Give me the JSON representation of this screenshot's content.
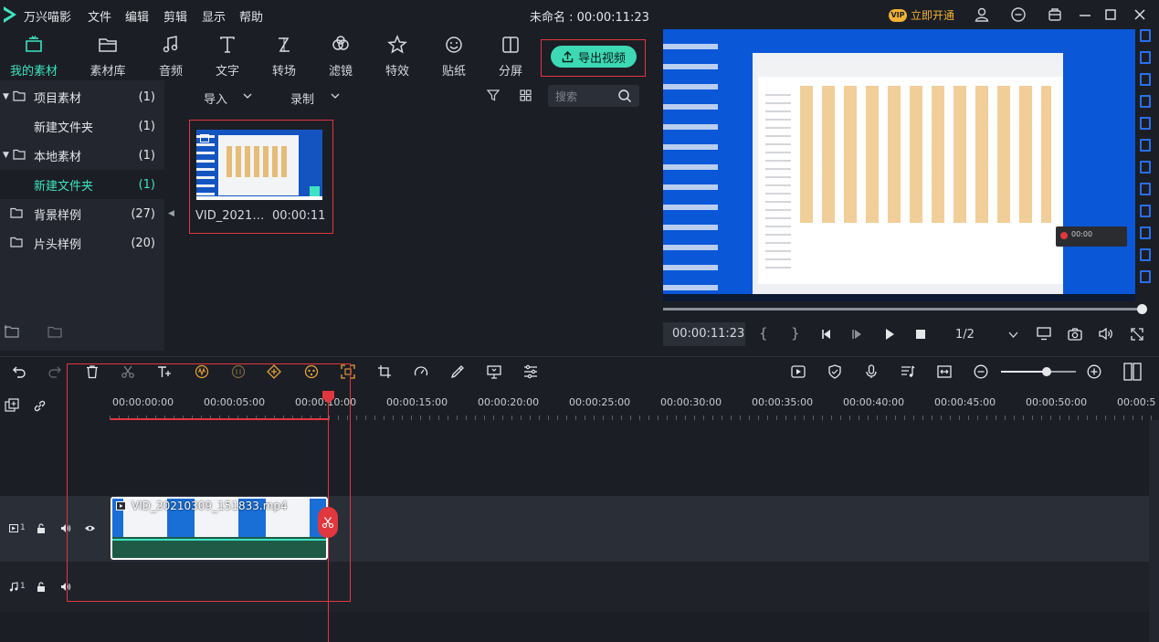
{
  "app": {
    "name": "万兴喵影",
    "title": "未命名 : 00:00:11:23",
    "menus": [
      "文件",
      "编辑",
      "剪辑",
      "显示",
      "帮助"
    ],
    "vip_label": "立即开通",
    "vip_badge": "VIP"
  },
  "toolbar": {
    "items": [
      {
        "label": "我的素材",
        "icon": "media-folder-icon",
        "active": true
      },
      {
        "label": "素材库",
        "icon": "library-folder-icon"
      },
      {
        "label": "音频",
        "icon": "music-note-icon"
      },
      {
        "label": "文字",
        "icon": "text-icon"
      },
      {
        "label": "转场",
        "icon": "transition-icon"
      },
      {
        "label": "滤镜",
        "icon": "filter-icon"
      },
      {
        "label": "特效",
        "icon": "effects-star-icon"
      },
      {
        "label": "贴纸",
        "icon": "sticker-smile-icon"
      },
      {
        "label": "分屏",
        "icon": "split-screen-icon"
      }
    ],
    "export_label": "导出视频"
  },
  "left_panel": {
    "items": [
      {
        "label": "项目素材",
        "count": "(1)",
        "expanded": true
      },
      {
        "label": "新建文件夹",
        "count": "(1)"
      },
      {
        "label": "本地素材",
        "count": "(1)",
        "expanded": true
      },
      {
        "label": "新建文件夹",
        "count": "(1)",
        "selected": true
      },
      {
        "label": "背景样例",
        "count": "(27)"
      },
      {
        "label": "片头样例",
        "count": "(20)"
      }
    ]
  },
  "media": {
    "import_label": "导入",
    "record_label": "录制",
    "search_placeholder": "搜索",
    "clip_name": "VID_2021…",
    "clip_duration": "00:00:11"
  },
  "preview": {
    "timecode": "00:00:11:23",
    "open_brace": "{",
    "close_brace": "}",
    "quality": "1/2",
    "rec_text": "00:00"
  },
  "timeline": {
    "ticks": [
      "00:00:00:00",
      "00:00:05:00",
      "00:00:10:00",
      "00:00:15:00",
      "00:00:20:00",
      "00:00:25:00",
      "00:00:30:00",
      "00:00:35:00",
      "00:00:40:00",
      "00:00:45:00",
      "00:00:50:00",
      "00:00:5"
    ],
    "clip_title": "VID_20210309_151833.mp4",
    "video_track_num": "1",
    "audio_track_num": "1"
  },
  "colors": {
    "accent": "#3ee4c1",
    "highlight": "#e0383e",
    "export_bg": "#3dd8b4",
    "vip": "#f1b136"
  }
}
